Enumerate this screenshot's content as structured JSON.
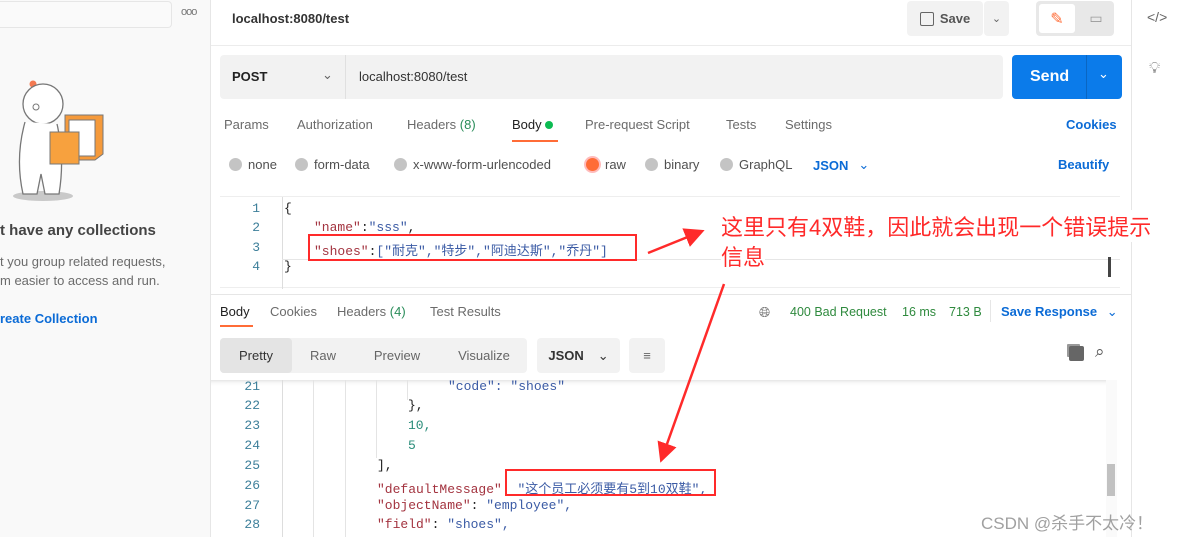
{
  "sidebar": {
    "empty_title": "t have any collections",
    "empty_desc_1": "t you group related requests,",
    "empty_desc_2": "m easier to access and run.",
    "create_link": "reate Collection",
    "more_icon": "more-icon"
  },
  "header": {
    "title": "localhost:8080/test",
    "save_label": "Save"
  },
  "request": {
    "method": "POST",
    "url": "localhost:8080/test",
    "send_label": "Send"
  },
  "tabs": [
    {
      "label": "Params"
    },
    {
      "label": "Authorization"
    },
    {
      "label": "Headers",
      "count": "(8)"
    },
    {
      "label": "Body"
    },
    {
      "label": "Pre-request Script"
    },
    {
      "label": "Tests"
    },
    {
      "label": "Settings"
    }
  ],
  "cookies_label": "Cookies",
  "body_types": [
    {
      "label": "none"
    },
    {
      "label": "form-data"
    },
    {
      "label": "x-www-form-urlencoded"
    },
    {
      "label": "raw",
      "selected": true
    },
    {
      "label": "binary"
    },
    {
      "label": "GraphQL"
    }
  ],
  "body_format": "JSON",
  "beautify_label": "Beautify",
  "editor": {
    "line_numbers": [
      "1",
      "2",
      "3",
      "4"
    ],
    "line1": "{",
    "name_key": "\"name\"",
    "name_val": "\"sss\"",
    "shoes_key": "\"shoes\"",
    "shoes_val": "[\"耐克\",\"特步\",\"阿迪达斯\",\"乔丹\"]",
    "line4": "}"
  },
  "response": {
    "tabs": [
      {
        "label": "Body"
      },
      {
        "label": "Cookies"
      },
      {
        "label": "Headers",
        "count": "(4)"
      },
      {
        "label": "Test Results"
      }
    ],
    "status": "400 Bad Request",
    "time": "16 ms",
    "size": "713 B",
    "save_label": "Save Response",
    "view_tabs": [
      "Pretty",
      "Raw",
      "Preview",
      "Visualize"
    ],
    "format": "JSON",
    "line_numbers": [
      "21",
      "22",
      "23",
      "24",
      "25",
      "26",
      "27",
      "28"
    ],
    "l21": "\"code\": \"shoes\"",
    "l22": "},",
    "l23": "10,",
    "l24": "5",
    "l25": "],",
    "l26_key": "\"defaultMessage\"",
    "l26_val": "\"这个员工必须要有5到10双鞋\",",
    "l27_key": "\"objectName\"",
    "l27_val": "\"employee\",",
    "l28_key": "\"field\"",
    "l28_val": "\"shoes\","
  },
  "annotation": {
    "line1": "这里只有4双鞋，因此就会出现一个错误提示",
    "line2": "信息",
    "color": "#ff2a2a"
  },
  "watermark": "CSDN @杀手不太冷！",
  "colors": {
    "accent": "#0b7bea",
    "orange": "#ff6c37",
    "status": "#2f8a3e"
  }
}
